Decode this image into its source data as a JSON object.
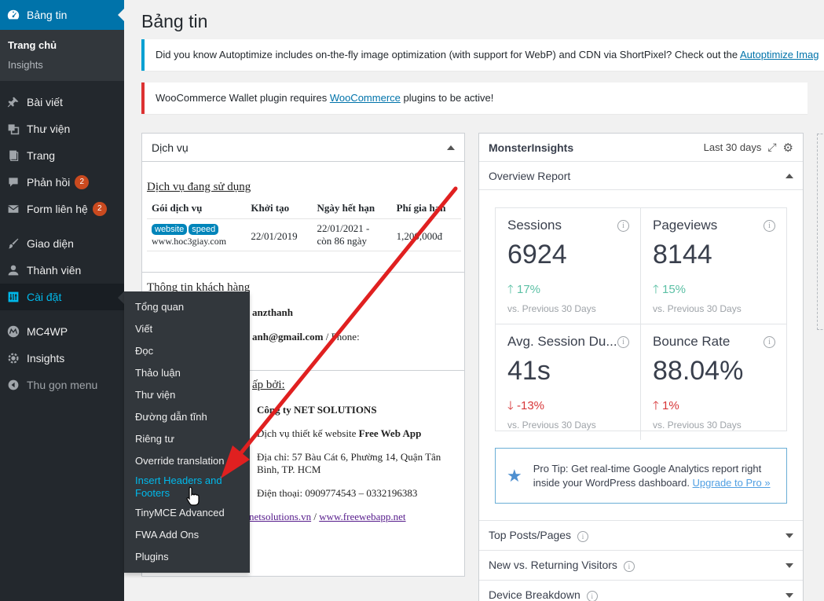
{
  "sidebar": {
    "dashboard": "Bảng tin",
    "sub_home": "Trang chủ",
    "sub_insights": "Insights",
    "posts": "Bài viết",
    "media": "Thư viện",
    "pages": "Trang",
    "comments": "Phản hồi",
    "comments_badge": "2",
    "forms": "Form liên hệ",
    "forms_badge": "2",
    "appearance": "Giao diện",
    "users": "Thành viên",
    "settings": "Cài đặt",
    "mc4wp": "MC4WP",
    "insights": "Insights",
    "collapse": "Thu gọn menu"
  },
  "flyout": [
    "Tổng quan",
    "Viết",
    "Đọc",
    "Thảo luận",
    "Thư viện",
    "Đường dẫn tĩnh",
    "Riêng tư",
    "Override translation",
    "Insert Headers and Footers",
    "TinyMCE Advanced",
    "FWA Add Ons",
    "Plugins"
  ],
  "page": {
    "title": "Bảng tin"
  },
  "notices": {
    "info_text": "Did you know Autoptimize includes on-the-fly image optimization (with support for WebP) and CDN via ShortPixel? Check out the ",
    "info_link": "Autoptimize Imag",
    "err_pre": "WooCommerce Wallet plugin requires ",
    "err_link": "WooCommerce",
    "err_post": " plugins to be active!"
  },
  "services": {
    "title": "Dịch vụ",
    "section_used": "Dịch vụ đang sử dụng",
    "headers": [
      "Gói dịch vụ",
      "Khởi tạo",
      "Ngày hết hạn",
      "Phí gia hạn"
    ],
    "tag1": "website",
    "tag2": "speed",
    "domain": "www.hoc3giay.com",
    "created": "22/01/2019",
    "expiry": "22/01/2021 -",
    "expiry_rem": "còn 86 ngày",
    "fee": "1,200,000đ",
    "customer_title": "Thông tin khách hàng",
    "cust_name": "anzthanh",
    "cust_email": "anh@gmail.com",
    "cust_phone": " / Phone:",
    "provider_title": "ấp bởi:",
    "company": "Công ty NET SOLUTIONS",
    "svc_pre": "Dịch vụ thiết kế website ",
    "svc_name": "Free Web App",
    "addr1": "Địa chỉ: 57 Bàu Cát 6, Phường 14, Quận Tân",
    "addr2": "Bình, TP. HCM",
    "phone": "Điện thoại: 0909774543 – 0332196383",
    "link1": "netsolutions.vn",
    "link_sep": " / ",
    "link2": "www.freewebapp.net"
  },
  "mi": {
    "title": "MonsterInsights",
    "range": "Last 30 days",
    "overview": "Overview Report",
    "metrics": [
      {
        "label": "Sessions",
        "value": "6924",
        "change": "17%",
        "dir": "up",
        "vs": "vs. Previous 30 Days"
      },
      {
        "label": "Pageviews",
        "value": "8144",
        "change": "15%",
        "dir": "up",
        "vs": "vs. Previous 30 Days"
      },
      {
        "label": "Avg. Session Du...",
        "value": "41s",
        "change": "-13%",
        "dir": "down",
        "vs": "vs. Previous 30 Days"
      },
      {
        "label": "Bounce Rate",
        "value": "88.04%",
        "change": "1%",
        "dir": "up_bad",
        "vs": "vs. Previous 30 Days"
      }
    ],
    "protip_text": "Pro Tip: Get real-time Google Analytics report right inside your WordPress dashboard. ",
    "protip_link": "Upgrade to Pro »",
    "sections": [
      "Top Posts/Pages",
      "New vs. Returning Visitors",
      "Device Breakdown"
    ]
  },
  "colors": {
    "accent": "#0073aa",
    "sidebar": "#23282d",
    "annotation": "#e02020"
  }
}
